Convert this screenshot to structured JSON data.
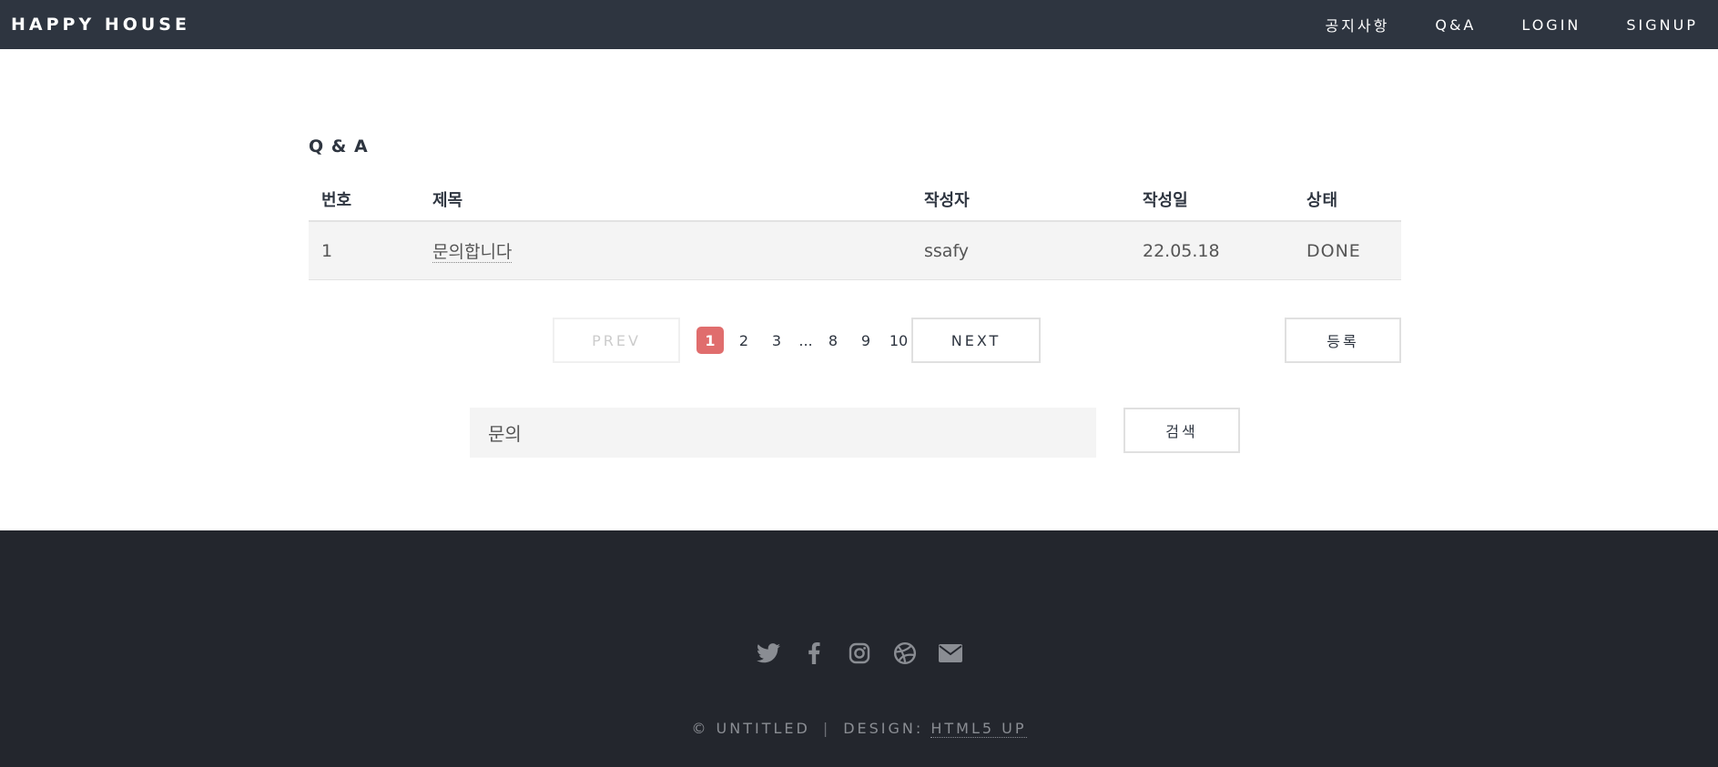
{
  "header": {
    "logo": "HAPPY HOUSE",
    "nav": [
      "공지사항",
      "Q&A",
      "LOGIN",
      "SIGNUP"
    ]
  },
  "main": {
    "title": "Q & A",
    "table": {
      "columns": [
        "번호",
        "제목",
        "작성자",
        "작성일",
        "상태"
      ],
      "rows": [
        {
          "no": "1",
          "title": "문의합니다",
          "author": "ssafy",
          "date": "22.05.18",
          "status": "DONE"
        }
      ]
    },
    "pagination": {
      "prev": "PREV",
      "pages": [
        "1",
        "2",
        "3",
        "...",
        "8",
        "9",
        "10"
      ],
      "active": "1",
      "next": "NEXT"
    },
    "register_label": "등록",
    "search": {
      "value": "문의",
      "button": "검색"
    }
  },
  "footer": {
    "icons": [
      "twitter-icon",
      "facebook-icon",
      "instagram-icon",
      "dribbble-icon",
      "envelope-icon"
    ],
    "copyright": "© UNTITLED",
    "sep": "|",
    "design_label": "DESIGN:",
    "design_link": "HTML5 UP"
  },
  "colors": {
    "header_bg": "#2e3540",
    "footer_bg": "#23262d",
    "accent": "#e06d6d"
  }
}
